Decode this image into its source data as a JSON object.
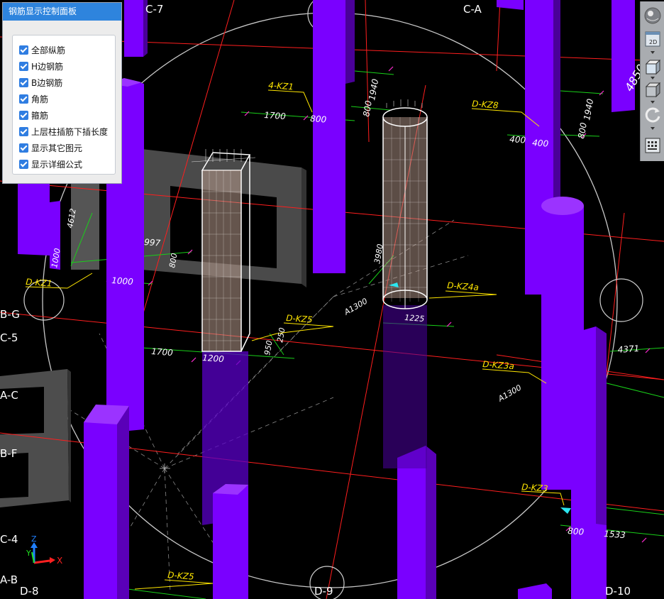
{
  "panel": {
    "title": "钢筋显示控制面板",
    "options": [
      {
        "label": "全部纵筋",
        "checked": true
      },
      {
        "label": "H边钢筋",
        "checked": true
      },
      {
        "label": "B边钢筋",
        "checked": true
      },
      {
        "label": "角筋",
        "checked": true
      },
      {
        "label": "箍筋",
        "checked": true
      },
      {
        "label": "上层柱插筋下插长度",
        "checked": true
      },
      {
        "label": "显示其它图元",
        "checked": true
      },
      {
        "label": "显示详细公式",
        "checked": true
      }
    ]
  },
  "toolbar": {
    "items": [
      "view-sphere-icon",
      "2d-view-icon",
      "3d-box-icon",
      "3d-solid-icon",
      "rotate-icon",
      "settings-panel-icon"
    ],
    "view_2d_label": "2D"
  },
  "axes": {
    "top": [
      "C-7",
      "C-A"
    ],
    "left": [
      "B-G",
      "C-5",
      "A-C",
      "B-F",
      "C-4",
      "A-B"
    ],
    "bottom": [
      "D-8",
      "D-9",
      "D-10"
    ]
  },
  "column_tags": {
    "kz1_top": "4-KZ1",
    "kz1_left": "D-KZ1",
    "kz8": "D-KZ8",
    "kz5_mid": "D-KZ5",
    "kz4a": "D-KZ4a",
    "kz3a": "D-KZ3a",
    "kz3": "D-KZ3",
    "kz5_bottom": "D-KZ5"
  },
  "dimensions": {
    "d1700_top": "1700",
    "d800_top": "800",
    "d1940_a": "1940",
    "d800_v": "800",
    "d1940_b": "1940",
    "d800_v2": "800",
    "d400_a": "400",
    "d400_b": "400",
    "d4850": "4850",
    "d4612": "4612",
    "d997": "997",
    "d800_c": "800",
    "d1000": "1000",
    "d1000_v": "1000",
    "d3980": "3980",
    "a1300_a": "A1300",
    "d1225": "1225",
    "d250": "250",
    "d950": "950",
    "d1700_mid": "1700",
    "d1200": "1200",
    "d4371": "4371",
    "a1300_b": "A1300",
    "d800_bottom": "800",
    "d1533": "1533"
  },
  "coord_axes": {
    "x": "X",
    "y": "Y",
    "z": "Z"
  },
  "colors": {
    "background": "#000000",
    "column_purple": "#7a00ff",
    "grid_red": "#ff1e1e",
    "dim_green": "#19d019",
    "tag_yellow": "#ffe600",
    "panel_header": "#2e84dd",
    "checkbox": "#2f7de1"
  }
}
